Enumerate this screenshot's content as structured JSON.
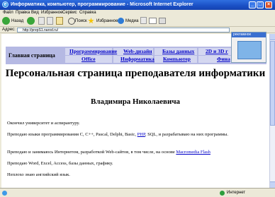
{
  "window": {
    "title": "Информатика, компьютер, программирование - Microsoft Internet Explorer",
    "controls": {
      "minimize": "_",
      "maximize": "□",
      "close": "×"
    }
  },
  "menu": [
    "Файл",
    "Правка",
    "Вид",
    "Избранное",
    "Сервис",
    "Справка"
  ],
  "toolbar": {
    "back_label": "Назад",
    "search_label": "Поиск",
    "favorites_label": "Избранное",
    "media_label": "Медиа"
  },
  "address": {
    "label": "Адрес:",
    "url": "http://prepS1.narod.ru/"
  },
  "nav": {
    "home": "Главная страница",
    "links": [
      "Программирование",
      "Web-дизайн",
      "Базы данных",
      "2D и 3D г",
      "Office",
      "Информатика",
      "Компьютер",
      "Фина"
    ]
  },
  "page": {
    "title": "Персональная страница преподавателя информатики",
    "subtitle": "Владимира Николаевича",
    "p1": "Окончил университет и аспирантуру.",
    "p2a": "Преподаю языки программирования C, C++, Pascal, Delphi, Basic, ",
    "p2link": "PHP",
    "p2b": ", SQL, и разрабатываю на них программы.",
    "p3a": "Преподаю и занимаюсь Интернетом, разработкой Web-сайтов, в том числе, на основе ",
    "p3link": "Macromedia Flash",
    "p4": "Преподаю Word, Excel, Access, базы данных, графику.",
    "p5": "Неплохо знаю английский язык."
  },
  "widget": {
    "label": "рекламное"
  },
  "status": {
    "zone": "Интернет"
  }
}
